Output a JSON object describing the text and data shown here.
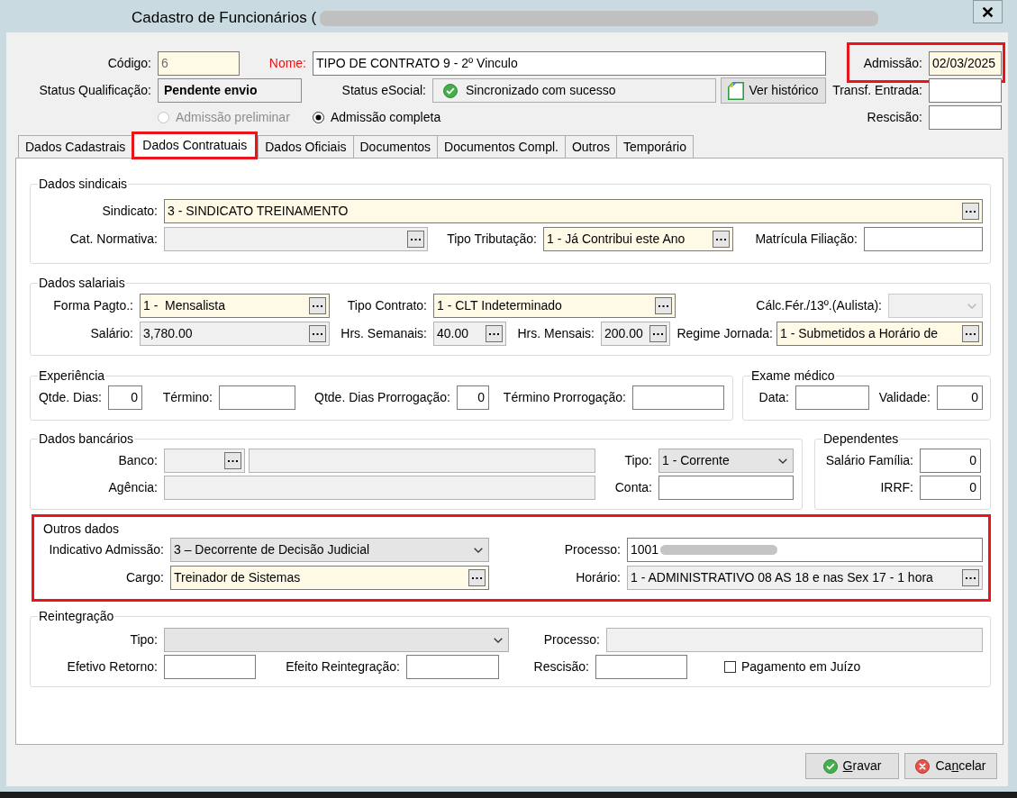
{
  "window": {
    "title": "Cadastro de Funcionários (",
    "title_redacted": true
  },
  "header": {
    "codigo": {
      "label": "Código:",
      "value": "6",
      "highlighted": true,
      "readonly": false,
      "disabled": true
    },
    "nome": {
      "label": "Nome:",
      "value": "TIPO DE CONTRATO 9 - 2º Vinculo",
      "highlighted": false,
      "readonly": false,
      "label_required": true
    },
    "admissao": {
      "label": "Admissão:",
      "value": "02/03/2025",
      "highlighted": true,
      "readonly": false,
      "annotated": true
    },
    "status_qualificacao": {
      "label": "Status Qualificação:",
      "value": "Pendente envio"
    },
    "status_esocial": {
      "label": "Status eSocial:",
      "value": "Sincronizado com sucesso",
      "synced": true
    },
    "history_button": {
      "label": "Ver histórico"
    },
    "transf_entrada": {
      "label": "Transf. Entrada:",
      "highlighted": false,
      "readonly": false
    },
    "rescisao": {
      "label": "Rescisão:",
      "highlighted": false,
      "readonly": false
    },
    "admission_type": [
      {
        "label": "Admissão preliminar",
        "selected": false,
        "disabled": true
      },
      {
        "label": "Admissão completa",
        "selected": true,
        "disabled": false
      }
    ]
  },
  "tabs": [
    {
      "label": "Dados Cadastrais",
      "selected": false,
      "annotated": false
    },
    {
      "label": "Dados Contratuais",
      "selected": true,
      "annotated": true
    },
    {
      "label": "Dados Oficiais",
      "selected": false,
      "annotated": false
    },
    {
      "label": "Documentos",
      "selected": false,
      "annotated": false
    },
    {
      "label": "Documentos Compl.",
      "selected": false,
      "annotated": false
    },
    {
      "label": "Outros",
      "selected": false,
      "annotated": false
    },
    {
      "label": "Temporário",
      "selected": false,
      "annotated": false
    }
  ],
  "groups": [
    {
      "title": "Dados sindicais",
      "annotated": false,
      "fields": [
        {
          "label": "Sindicato:",
          "kind": "lookup",
          "highlighted": true,
          "readonly": false,
          "value": "3 - SINDICATO TREINAMENTO"
        },
        {
          "label": "Cat. Normativa:",
          "kind": "lookup",
          "highlighted": false,
          "readonly": true
        },
        {
          "label": "Tipo Tributação:",
          "kind": "lookup",
          "highlighted": true,
          "readonly": false,
          "value": "1 - Já Contribui este Ano"
        },
        {
          "label": "Matrícula Filiação:",
          "kind": "text",
          "highlighted": false,
          "readonly": false
        }
      ]
    },
    {
      "title": "Dados salariais",
      "annotated": false,
      "fields": [
        {
          "label": "Forma Pagto.:",
          "kind": "lookup",
          "highlighted": true,
          "readonly": false,
          "value": "1 -  Mensalista"
        },
        {
          "label": "Tipo Contrato:",
          "kind": "lookup",
          "highlighted": true,
          "readonly": false,
          "value": "1 - CLT Indeterminado"
        },
        {
          "label": "Cálc.Fér./13º.(Aulista):",
          "kind": "combo",
          "highlighted": false,
          "readonly": true
        },
        {
          "label": "Salário:",
          "kind": "lookup",
          "highlighted": false,
          "readonly": true,
          "value": "3,780.00"
        },
        {
          "label": "Hrs. Semanais:",
          "kind": "lookup",
          "highlighted": false,
          "readonly": true,
          "value": "40.00"
        },
        {
          "label": "Hrs. Mensais:",
          "kind": "lookup",
          "highlighted": false,
          "readonly": true,
          "value": "200.00"
        },
        {
          "label": "Regime Jornada:",
          "kind": "lookup",
          "highlighted": true,
          "readonly": false,
          "value": "1 - Submetidos a Horário de"
        }
      ]
    },
    {
      "title": "Experiência",
      "annotated": false,
      "fields": [
        {
          "label": "Qtde. Dias:",
          "kind": "number",
          "highlighted": false,
          "readonly": false,
          "value": "0"
        },
        {
          "label": "Término:",
          "kind": "text",
          "highlighted": false,
          "readonly": false
        },
        {
          "label": "Qtde. Dias Prorrogação:",
          "kind": "number",
          "highlighted": false,
          "readonly": false,
          "value": "0"
        },
        {
          "label": "Término Prorrogação:",
          "kind": "text",
          "highlighted": false,
          "readonly": false
        }
      ]
    },
    {
      "title": "Exame médico",
      "annotated": false,
      "fields": [
        {
          "label": "Data:",
          "kind": "text",
          "highlighted": false,
          "readonly": false
        },
        {
          "label": "Validade:",
          "kind": "number",
          "highlighted": false,
          "readonly": false,
          "value": "0"
        }
      ]
    },
    {
      "title": "Dados bancários",
      "annotated": false,
      "fields": [
        {
          "label": "Banco:",
          "kind": "lookup",
          "highlighted": false,
          "readonly": true
        },
        {
          "kind": "text",
          "highlighted": false,
          "readonly": true
        },
        {
          "label": "Tipo:",
          "kind": "combo",
          "highlighted": false,
          "readonly": false,
          "value": "1 - Corrente"
        },
        {
          "label": "Agência:",
          "kind": "text",
          "highlighted": false,
          "readonly": true
        },
        {
          "label": "Conta:",
          "kind": "text",
          "highlighted": false,
          "readonly": false
        }
      ]
    },
    {
      "title": "Dependentes",
      "annotated": false,
      "fields": [
        {
          "label": "Salário Família:",
          "kind": "number",
          "highlighted": false,
          "readonly": false,
          "value": "0"
        },
        {
          "label": "IRRF:",
          "kind": "number",
          "highlighted": false,
          "readonly": false,
          "value": "0"
        }
      ]
    },
    {
      "title": "Outros dados",
      "annotated": true,
      "fields": [
        {
          "label": "Indicativo Admissão:",
          "kind": "combo",
          "highlighted": false,
          "readonly": false,
          "value": "3 – Decorrente de Decisão Judicial"
        },
        {
          "label": "Processo:",
          "kind": "text",
          "highlighted": false,
          "readonly": false,
          "value": "1001",
          "redacted": true
        },
        {
          "label": "Cargo:",
          "kind": "lookup",
          "highlighted": true,
          "readonly": false,
          "value": "Treinador de Sistemas"
        },
        {
          "label": "Horário:",
          "kind": "lookup",
          "highlighted": false,
          "readonly": true,
          "value": "1 - ADMINISTRATIVO 08 AS 18 e nas Sex 17 - 1 hora"
        }
      ]
    },
    {
      "title": "Reintegração",
      "annotated": false,
      "fields": [
        {
          "label": "Tipo:",
          "kind": "combo",
          "highlighted": false,
          "readonly": false
        },
        {
          "label": "Processo:",
          "kind": "text",
          "highlighted": false,
          "readonly": true
        },
        {
          "label": "Efetivo Retorno:",
          "kind": "text",
          "highlighted": false,
          "readonly": false
        },
        {
          "label": "Efeito Reintegração:",
          "kind": "text",
          "highlighted": false,
          "readonly": false
        },
        {
          "label": "Rescisão:",
          "kind": "text",
          "highlighted": false,
          "readonly": false
        },
        {
          "label": "Pagamento em Juízo",
          "kind": "checkbox",
          "checked": false
        }
      ]
    }
  ],
  "buttons": [
    {
      "kind": "save",
      "parts": [
        {
          "text": "G",
          "underlined": true
        },
        {
          "text": "ravar",
          "underlined": false
        }
      ]
    },
    {
      "kind": "cancel",
      "parts": [
        {
          "text": "Ca",
          "underlined": false
        },
        {
          "text": "n",
          "underlined": true
        },
        {
          "text": "celar",
          "underlined": false
        }
      ]
    }
  ]
}
